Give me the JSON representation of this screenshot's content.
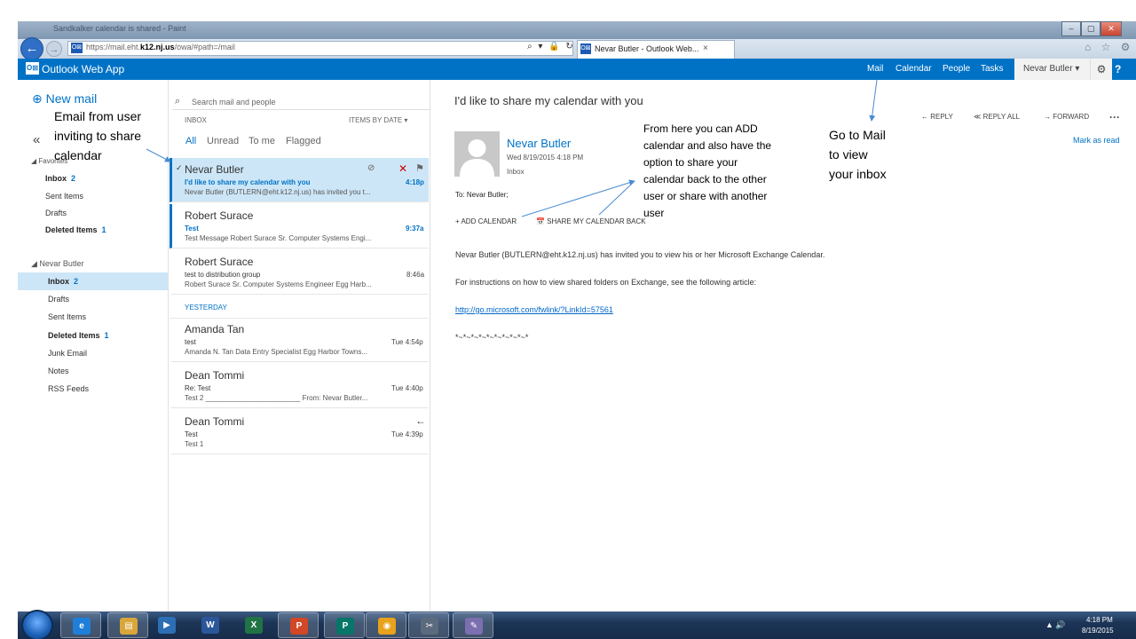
{
  "browser": {
    "window_title": "Sandkalker calendar is shared - Paint",
    "url_prefix": "https://mail.eht.",
    "url_host": "k12.nj.us",
    "url_path": "/owa/#path=/mail",
    "tab_title": "Nevar Butler - Outlook Web...",
    "tab_close": "×",
    "addr_tools": "⌕ ▾ 🔒 ↻",
    "icons": "⌂ ☆ ⚙",
    "back": "←",
    "forward": "→",
    "win_min": "–",
    "win_max": "▢",
    "win_close": "✕"
  },
  "owa": {
    "app_title": "Outlook Web App",
    "logo": "O⊠",
    "nav": {
      "mail": "Mail",
      "calendar": "Calendar",
      "people": "People",
      "tasks": "Tasks"
    },
    "user": "Nevar Butler ▾",
    "gear": "⚙",
    "help": "?"
  },
  "folders": {
    "new_mail_icon": "⊕",
    "new_mail": "New mail",
    "collapse": "«",
    "favorites_header": "◢ Favorites",
    "favorites": [
      {
        "label": "Inbox",
        "count": "2"
      },
      {
        "label": "Sent Items",
        "count": ""
      },
      {
        "label": "Drafts",
        "count": ""
      },
      {
        "label": "Deleted Items",
        "count": "1"
      }
    ],
    "account_header": "◢ Nevar Butler",
    "account": [
      {
        "label": "Inbox",
        "count": "2"
      },
      {
        "label": "Drafts",
        "count": ""
      },
      {
        "label": "Sent Items",
        "count": ""
      },
      {
        "label": "Deleted Items",
        "count": "1"
      },
      {
        "label": "Junk Email",
        "count": ""
      },
      {
        "label": "Notes",
        "count": ""
      },
      {
        "label": "RSS Feeds",
        "count": ""
      }
    ]
  },
  "list": {
    "search_icon": "⌕",
    "search_placeholder": "Search mail and people",
    "folder": "INBOX",
    "sort": "ITEMS BY DATE ▾",
    "filters": [
      "All",
      "Unread",
      "To me",
      "Flagged"
    ],
    "yesterday": "YESTERDAY",
    "messages": [
      {
        "sender": "Nevar Butler",
        "subject": "I'd like to share my calendar with you",
        "preview": "Nevar Butler (BUTLERN@eht.k12.nj.us) has invited you t...",
        "time": "4:18p",
        "check": "✓",
        "clip": "⊘",
        "delete": "✕",
        "flag": "⚑"
      },
      {
        "sender": "Robert Surace",
        "subject": "Test",
        "preview": "Test Message Robert Surace Sr. Computer Systems Engi...",
        "time": "9:37a"
      },
      {
        "sender": "Robert Surace",
        "subject": "test to distribution group",
        "preview": "Robert Surace Sr. Computer Systems Engineer Egg Harb...",
        "time": "8:46a"
      },
      {
        "sender": "Amanda Tan",
        "subject": "test",
        "preview": "Amanda N. Tan Data Entry Specialist Egg Harbor Towns...",
        "time": "Tue 4:54p"
      },
      {
        "sender": "Dean Tommi",
        "subject": "Re: Test",
        "preview": "Test 2 ________________________ From: Nevar Butler...",
        "time": "Tue 4:40p"
      },
      {
        "sender": "Dean Tommi",
        "subject": "Test",
        "preview": "Test 1",
        "time": "Tue 4:39p",
        "reply_icon": "←"
      }
    ]
  },
  "reading": {
    "subject": "I'd like to share my calendar with you",
    "actions": {
      "reply": "← REPLY",
      "reply_all": "≪ REPLY ALL",
      "forward": "→ FORWARD",
      "more": "···"
    },
    "mark_read": "Mark as read",
    "sender": "Nevar Butler",
    "date": "Wed 8/19/2015 4:18 PM",
    "folder": "Inbox",
    "to": "To:  Nevar Butler;",
    "add_calendar": "+  ADD CALENDAR",
    "share_calendar": "📅  SHARE MY CALENDAR BACK",
    "body": [
      "Nevar Butler (BUTLERN@eht.k12.nj.us) has invited you to view his or her Microsoft Exchange Calendar.",
      "For instructions on how to view shared folders on Exchange, see the following article:",
      "http://go.microsoft.com/fwlink/?LinkId=57561",
      "*~*~*~*~*~*~*~*~*~*"
    ]
  },
  "annotations": {
    "email_note": [
      "Email from user",
      "inviting to share",
      "calendar"
    ],
    "add_note": [
      "From here you can ADD",
      "calendar and also have the",
      "option to share your",
      "calendar back to the other",
      "user or share with another",
      "user"
    ],
    "mail_note": [
      "Go to Mail",
      "to view",
      "your inbox"
    ]
  },
  "taskbar": {
    "time": "4:18 PM",
    "date": "8/19/2015",
    "tray": "▲  🔊",
    "apps": [
      {
        "name": "internet-explorer",
        "glyph": "e",
        "color": "#1f7fd8"
      },
      {
        "name": "file-explorer",
        "glyph": "▤",
        "color": "#d9a63a"
      },
      {
        "name": "media-player",
        "glyph": "▶",
        "color": "#2d6fb5"
      },
      {
        "name": "word",
        "glyph": "W",
        "color": "#2b579a"
      },
      {
        "name": "excel",
        "glyph": "X",
        "color": "#217346"
      },
      {
        "name": "powerpoint",
        "glyph": "P",
        "color": "#d24726"
      },
      {
        "name": "publisher",
        "glyph": "P",
        "color": "#077568"
      },
      {
        "name": "chrome",
        "glyph": "◉",
        "color": "#e8a21b"
      },
      {
        "name": "snipping-tool",
        "glyph": "✂",
        "color": "#5b6b7d"
      },
      {
        "name": "paint",
        "glyph": "✎",
        "color": "#7b6fb0"
      }
    ]
  },
  "colors": {
    "accent": "#0072c6",
    "selection": "#cde6f7"
  }
}
